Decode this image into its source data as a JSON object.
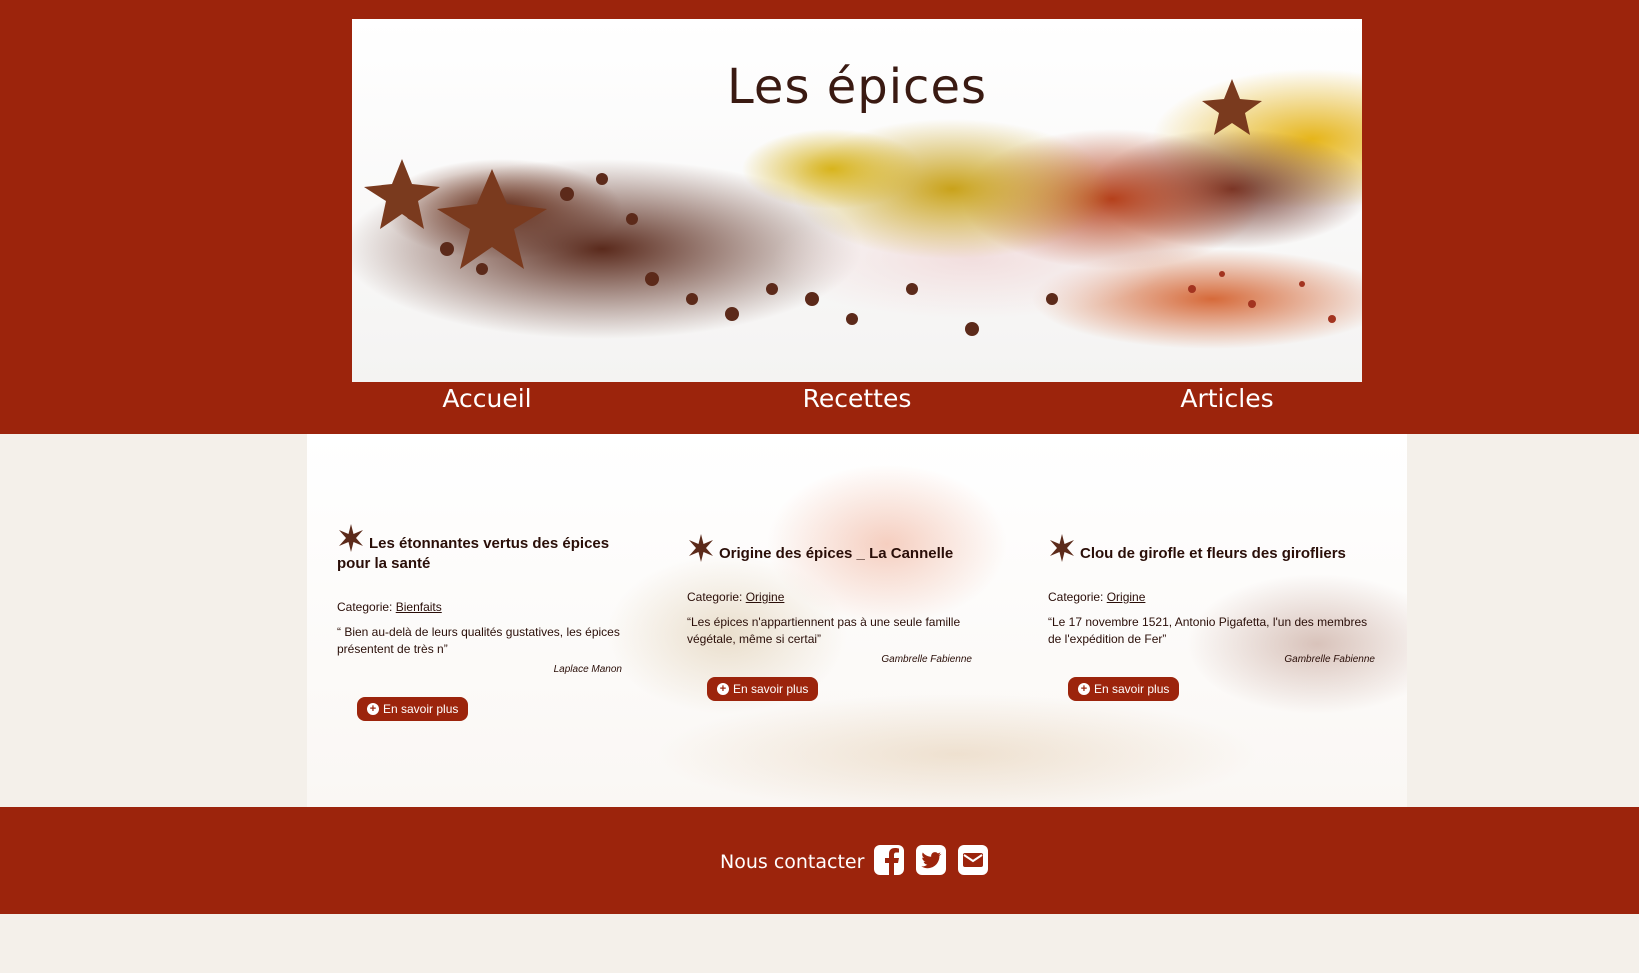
{
  "header": {
    "title": "Les épices",
    "nav": [
      {
        "label": "Accueil"
      },
      {
        "label": "Recettes"
      },
      {
        "label": "Articles"
      }
    ]
  },
  "articles": [
    {
      "title": "Les étonnantes vertus des épices pour la santé",
      "category_label": "Categorie:",
      "category": "Bienfaits",
      "excerpt": "“ Bien au-delà de leurs qualités gustatives, les épices présentent de très n”",
      "author": "Laplace Manon",
      "button": "En savoir plus"
    },
    {
      "title": "Origine des épices _ La Cannelle",
      "category_label": "Categorie:",
      "category": "Origine",
      "excerpt": "“Les épices n'appartiennent pas à une seule famille végétale, même si certai”",
      "author": "Gambrelle Fabienne",
      "button": "En savoir plus"
    },
    {
      "title": "Clou de girofle et fleurs des girofliers",
      "category_label": "Categorie:",
      "category": "Origine",
      "excerpt": "“Le 17 novembre 1521, Antonio Pigafetta, l'un des membres de l'expédition de Fer”",
      "author": "Gambrelle Fabienne",
      "button": "En savoir plus"
    }
  ],
  "footer": {
    "contact_label": "Nous contacter",
    "social": [
      "facebook-icon",
      "twitter-icon",
      "email-icon"
    ]
  },
  "colors": {
    "brand": "#9c240c",
    "background": "#f4f0ea",
    "text": "#2a0e08"
  }
}
